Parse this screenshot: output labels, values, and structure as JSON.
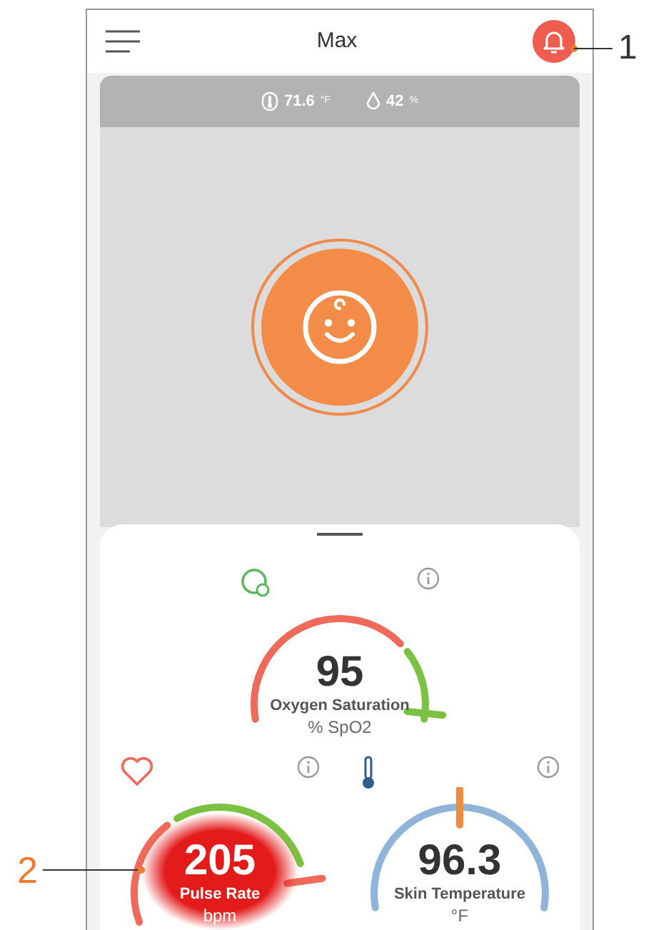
{
  "header": {
    "title": "Max",
    "alarm": true
  },
  "environment": [
    {
      "kind": "temperature",
      "value": "71.6",
      "unit": "°F"
    },
    {
      "kind": "humidity",
      "value": "42",
      "unit": "%"
    }
  ],
  "metrics": [
    {
      "kind": "oxygen",
      "value": "95",
      "label": "Oxygen Saturation",
      "unit": "% SpO2",
      "alert": false
    },
    {
      "kind": "pulse",
      "value": "205",
      "label": "Pulse Rate",
      "unit": "bpm",
      "alert": true
    },
    {
      "kind": "temperature",
      "value": "96.3",
      "label": "Skin Temperature",
      "unit": "°F",
      "alert": false
    }
  ],
  "callouts": [
    "1",
    "2"
  ]
}
